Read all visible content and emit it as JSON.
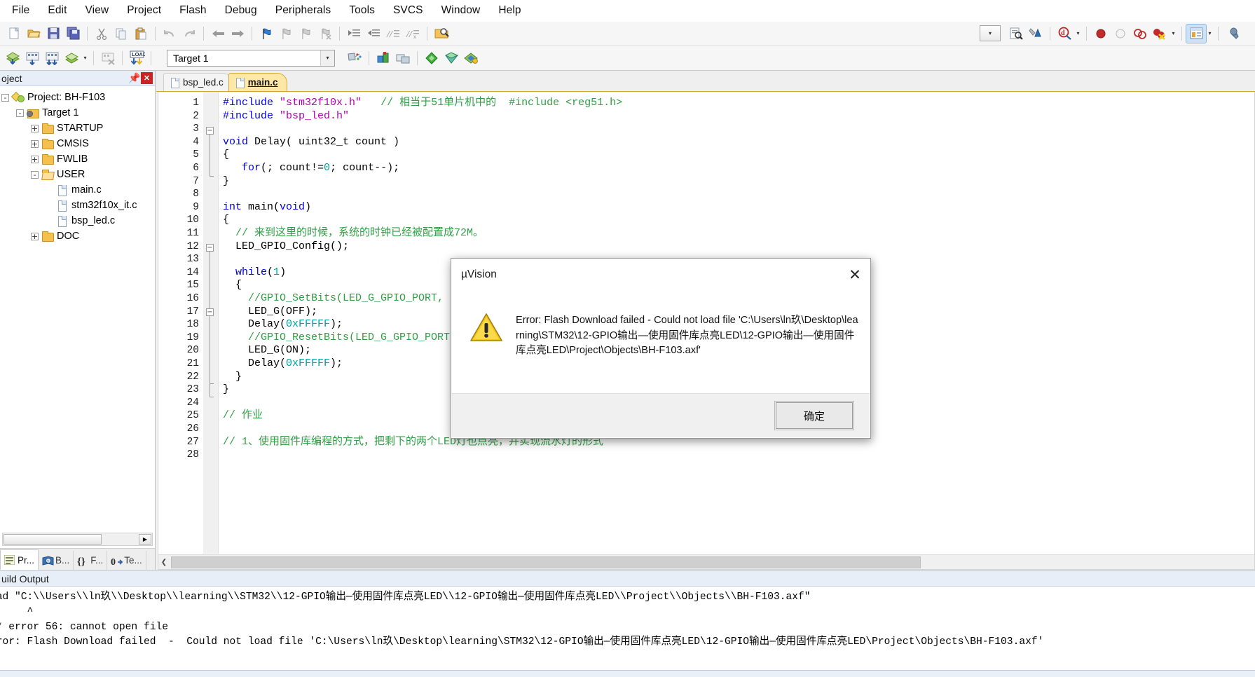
{
  "menu": {
    "items": [
      "File",
      "Edit",
      "View",
      "Project",
      "Flash",
      "Debug",
      "Peripherals",
      "Tools",
      "SVCS",
      "Window",
      "Help"
    ]
  },
  "toolbar2": {
    "target_value": "Target 1"
  },
  "project_panel": {
    "title": "oject",
    "tree": [
      {
        "label": "Project: BH-F103",
        "depth": 0,
        "expander": "-",
        "icon": "project-icon"
      },
      {
        "label": "Target 1",
        "depth": 1,
        "expander": "-",
        "icon": "target-folder-icon"
      },
      {
        "label": "STARTUP",
        "depth": 2,
        "expander": "+",
        "icon": "folder-icon"
      },
      {
        "label": "CMSIS",
        "depth": 2,
        "expander": "+",
        "icon": "folder-icon"
      },
      {
        "label": "FWLIB",
        "depth": 2,
        "expander": "+",
        "icon": "folder-icon"
      },
      {
        "label": "USER",
        "depth": 2,
        "expander": "-",
        "icon": "folder-open-icon"
      },
      {
        "label": "main.c",
        "depth": 3,
        "expander": "",
        "icon": "file-icon"
      },
      {
        "label": "stm32f10x_it.c",
        "depth": 3,
        "expander": "",
        "icon": "file-icon"
      },
      {
        "label": "bsp_led.c",
        "depth": 3,
        "expander": "",
        "icon": "file-icon"
      },
      {
        "label": "DOC",
        "depth": 2,
        "expander": "+",
        "icon": "folder-icon"
      }
    ],
    "tabs": [
      {
        "label": "Pr...",
        "icon": "project-tab-icon",
        "selected": true
      },
      {
        "label": "B...",
        "icon": "books-tab-icon",
        "selected": false
      },
      {
        "label": "F...",
        "icon": "braces-tab-icon",
        "selected": false
      },
      {
        "label": "Te...",
        "icon": "templates-tab-icon",
        "selected": false
      }
    ]
  },
  "editor": {
    "tabs": [
      {
        "label": "bsp_led.c",
        "selected": false
      },
      {
        "label": "main.c",
        "selected": true
      }
    ],
    "lines": [
      {
        "n": 1,
        "html": "<span class=\"pp\" style=\"color:#0000e6\">#include</span> <span class=\"str\">\"stm32f10x.h\"</span>   <span class=\"cmt\">// 相当于51单片机中的  #include &lt;reg51.h&gt;</span>"
      },
      {
        "n": 2,
        "html": "<span class=\"pp\" style=\"color:#0000e6\">#include</span> <span class=\"str\">\"bsp_led.h\"</span>"
      },
      {
        "n": 3,
        "html": ""
      },
      {
        "n": 4,
        "html": "<span class=\"kw\">void</span> Delay( uint32_t count )"
      },
      {
        "n": 5,
        "html": "{"
      },
      {
        "n": 6,
        "html": "   <span class=\"kw\">for</span>(; count!=<span class=\"num\">0</span>; count--);"
      },
      {
        "n": 7,
        "html": "}"
      },
      {
        "n": 8,
        "html": ""
      },
      {
        "n": 9,
        "html": "<span class=\"kw\">int</span> main(<span class=\"kw\">void</span>)"
      },
      {
        "n": 10,
        "html": "{"
      },
      {
        "n": 11,
        "html": "  <span class=\"cmt\">// 来到这里的时候，系统的时钟已经被配置成72M。</span>"
      },
      {
        "n": 12,
        "html": "  LED_GPIO_Config();"
      },
      {
        "n": 13,
        "html": ""
      },
      {
        "n": 14,
        "html": "  <span class=\"kw\">while</span>(<span class=\"num\">1</span>)"
      },
      {
        "n": 15,
        "html": "  {"
      },
      {
        "n": 16,
        "html": "    <span class=\"cmt\">//GPIO_SetBits(LED_G_GPIO_PORT, LED_G_GPIO_PIN);</span>"
      },
      {
        "n": 17,
        "html": "    LED_G(OFF);"
      },
      {
        "n": 18,
        "html": "    Delay(<span class=\"num\">0xFFFFF</span>);"
      },
      {
        "n": 19,
        "html": "    <span class=\"cmt\">//GPIO_ResetBits(LED_G_GPIO_PORT, LED_G_GPIO_PIN);</span>"
      },
      {
        "n": 20,
        "html": "    LED_G(ON);"
      },
      {
        "n": 21,
        "html": "    Delay(<span class=\"num\">0xFFFFF</span>);"
      },
      {
        "n": 22,
        "html": "  }"
      },
      {
        "n": 23,
        "html": "}"
      },
      {
        "n": 24,
        "html": ""
      },
      {
        "n": 25,
        "html": "<span class=\"cmt\">// 作业</span>"
      },
      {
        "n": 26,
        "html": ""
      },
      {
        "n": 27,
        "html": "<span class=\"cmt\">// 1、使用固件库编程的方式，把剩下的两个LED灯也点亮，并实现流水灯的形式</span>"
      },
      {
        "n": 28,
        "html": ""
      }
    ]
  },
  "build_output": {
    "title": "uild Output",
    "lines": [
      "oad \"C:\\\\Users\\\\ln玖\\\\Desktop\\\\learning\\\\STM32\\\\12-GPIO输出—使用固件库点亮LED\\\\12-GPIO输出—使用固件库点亮LED\\\\Project\\\\Objects\\\\BH-F103.axf\"",
      "      ^",
      "** error 56: cannot open file",
      "rror: Flash Download failed  -  Could not load file 'C:\\Users\\ln玖\\Desktop\\learning\\STM32\\12-GPIO输出—使用固件库点亮LED\\12-GPIO输出—使用固件库点亮LED\\Project\\Objects\\BH-F103.axf'"
    ]
  },
  "dialog": {
    "title": "µVision",
    "close_label": "✕",
    "message": "Error: Flash Download failed  -  Could not load file 'C:\\Users\\ln玖\\Desktop\\learning\\STM32\\12-GPIO输出—使用固件库点亮LED\\12-GPIO输出—使用固件库点亮LED\\Project\\Objects\\BH-F103.axf'",
    "ok_label": "确定"
  },
  "colors": {
    "accent": "#e8eef7",
    "tab_selected": "#fde8a8",
    "comment_green": "#2f9e44",
    "string_magenta": "#b000b0",
    "keyword_blue": "#0000e6",
    "error_red": "#cc2222"
  }
}
